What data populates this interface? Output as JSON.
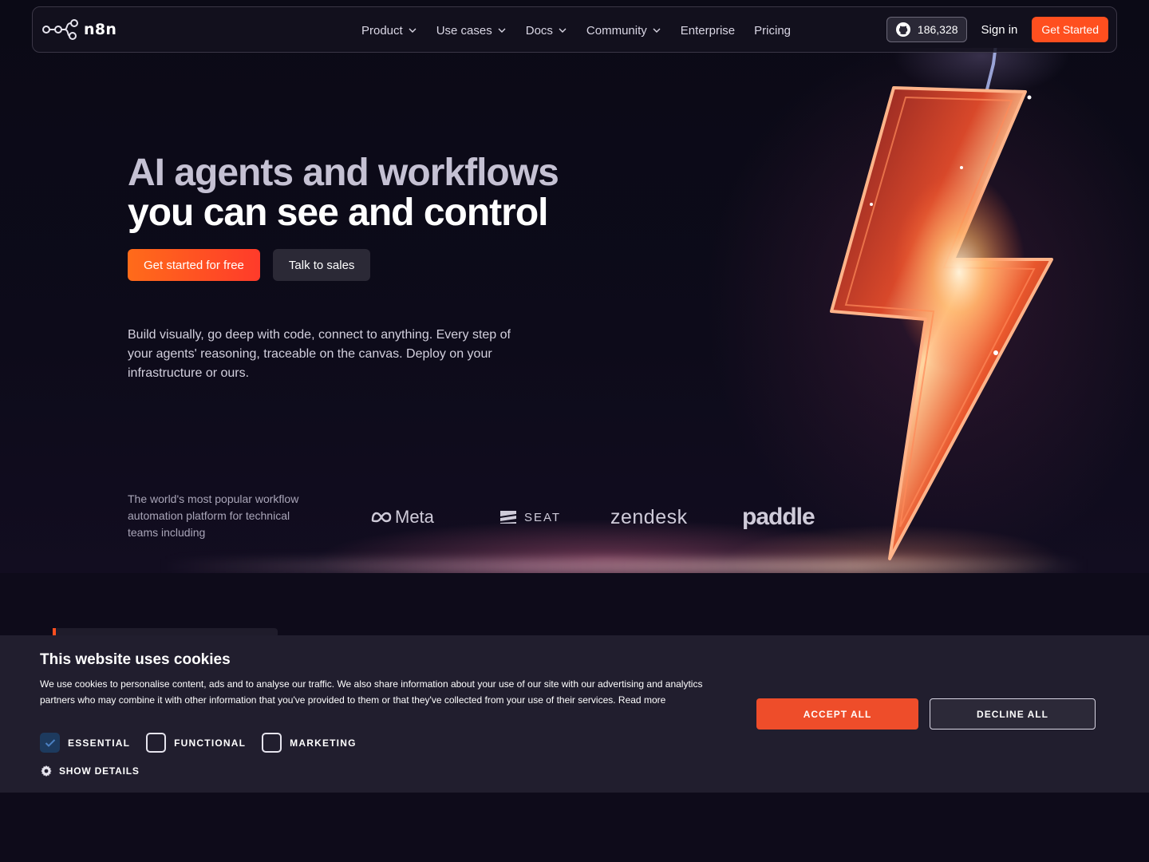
{
  "nav": {
    "logo_text": "n8n",
    "links": [
      {
        "label": "Product",
        "dropdown": true
      },
      {
        "label": "Use cases",
        "dropdown": true
      },
      {
        "label": "Docs",
        "dropdown": true
      },
      {
        "label": "Community",
        "dropdown": true
      },
      {
        "label": "Enterprise",
        "dropdown": false
      },
      {
        "label": "Pricing",
        "dropdown": false
      }
    ],
    "github_stars": "186,328",
    "signin_label": "Sign in",
    "get_started_label": "Get Started"
  },
  "hero": {
    "headline_line1": "AI agents and workflows",
    "headline_line2": "you can see and control",
    "cta_primary": "Get started for free",
    "cta_secondary": "Talk to sales",
    "subtitle": "Build visually, go deep with code, connect to anything. Every step of your agents' reasoning, traceable on the canvas. Deploy on your infrastructure or ours.",
    "trust_text": "The world's most popular workflow automation platform for technical teams including",
    "brands": [
      "Meta",
      "SEAT",
      "zendesk",
      "paddle"
    ]
  },
  "cookie": {
    "title": "This website uses cookies",
    "text": "We use cookies to personalise content, ads and to analyse our traffic. We also share information about your use of our site with our advertising and analytics partners who may combine it with other information that you've provided to them or that they've collected from your use of their services. Read more",
    "checkboxes": [
      {
        "label": "ESSENTIAL",
        "checked": true
      },
      {
        "label": "FUNCTIONAL",
        "checked": false
      },
      {
        "label": "MARKETING",
        "checked": false
      }
    ],
    "show_details": "SHOW DETAILS",
    "accept_label": "ACCEPT ALL",
    "decline_label": "DECLINE ALL"
  },
  "colors": {
    "accent": "#ff4f1f",
    "background": "#0e0b1a",
    "banner": "#211e2e"
  }
}
